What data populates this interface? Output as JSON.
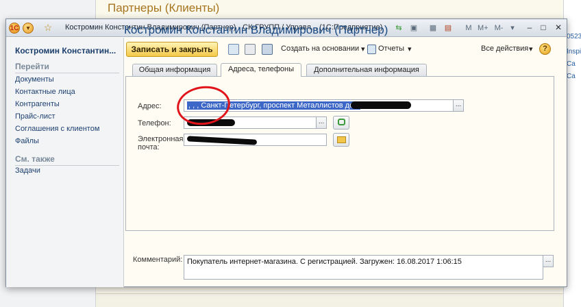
{
  "background": {
    "title": "Партнеры (Клиенты)",
    "right_fragments": [
      "0523",
      "Inspi",
      "Ca",
      "Ca"
    ]
  },
  "window": {
    "title": "Костромин Константин Владимирович (Партнер) - СК-ГРУПП / Управл... (1С:Предприятие)",
    "logo_icon": "1c-logo-icon",
    "tools": [
      "M",
      "M+",
      "M-"
    ],
    "controls": [
      "–",
      "□",
      "✕"
    ]
  },
  "nav": {
    "heading": "Костромин Константин...",
    "go_section": "Перейти",
    "go_items": [
      "Документы",
      "Контактные лица",
      "Контрагенты",
      "Прайс-лист",
      "Соглашения с клиентом",
      "Файлы"
    ],
    "see_also_section": "См. также",
    "see_also_items": [
      "Задачи"
    ]
  },
  "form": {
    "title": "Костромин Константин Владимирович (Партнер)",
    "toolbar": {
      "save_close": "Записать и закрыть",
      "create_based": "Создать на основании",
      "reports": "Отчеты",
      "all_actions": "Все действия",
      "help": "?"
    },
    "tabs": [
      "Общая информация",
      "Адреса, телефоны",
      "Дополнительная информация"
    ],
    "active_tab": 1,
    "address": {
      "label": "Адрес:",
      "value": ", , , Санкт-Петербург, проспект Металлистов дом"
    },
    "phone": {
      "label": "Телефон:"
    },
    "email": {
      "label_line1": "Электронная",
      "label_line2": "почта:"
    },
    "comment": {
      "label": "Комментарий:",
      "value": "Покупатель интернет-магазина. С регистрацией. Загружен: 16.08.2017 1:06:15"
    },
    "colors": {
      "title": "#1b4a83",
      "save_button": "#f4c94a",
      "selection": "#3c67c6",
      "annotation_circle": "#e0141a"
    }
  }
}
